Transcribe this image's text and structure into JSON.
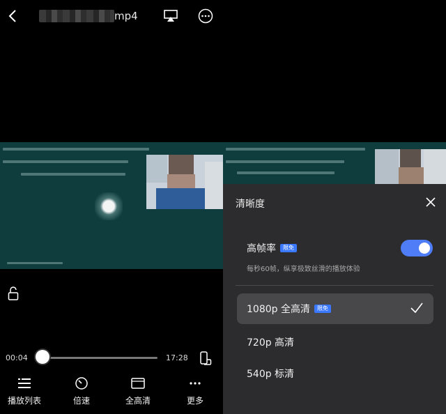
{
  "header": {
    "title_suffix": "mp4",
    "icons": [
      "back-icon",
      "airplay-icon",
      "more-icon"
    ]
  },
  "player": {
    "current_time": "00:04",
    "total_time": "17:28",
    "progress": 0.004
  },
  "bottom_bar": {
    "items": [
      {
        "label": "播放列表",
        "icon": "playlist-icon"
      },
      {
        "label": "倍速",
        "icon": "speed-icon"
      },
      {
        "label": "全高清",
        "icon": "quality-icon"
      },
      {
        "label": "更多",
        "icon": "more-icon"
      }
    ]
  },
  "quality_panel": {
    "title": "清晰度",
    "high_frame_rate": {
      "label": "高帧率",
      "badge": "限免",
      "description": "每秒60帧，纵享极致丝滑的播放体验",
      "enabled": true
    },
    "options": [
      {
        "label": "1080p 全高清",
        "badge": "限免",
        "selected": true
      },
      {
        "label": "720p 高清",
        "badge": "",
        "selected": false
      },
      {
        "label": "540p 标清",
        "badge": "",
        "selected": false
      }
    ]
  },
  "colors": {
    "accent": "#4f7cf7",
    "panel_bg": "#2c2c2e",
    "video_bg": "#0f3d3d",
    "badge": "#3a78ff"
  }
}
